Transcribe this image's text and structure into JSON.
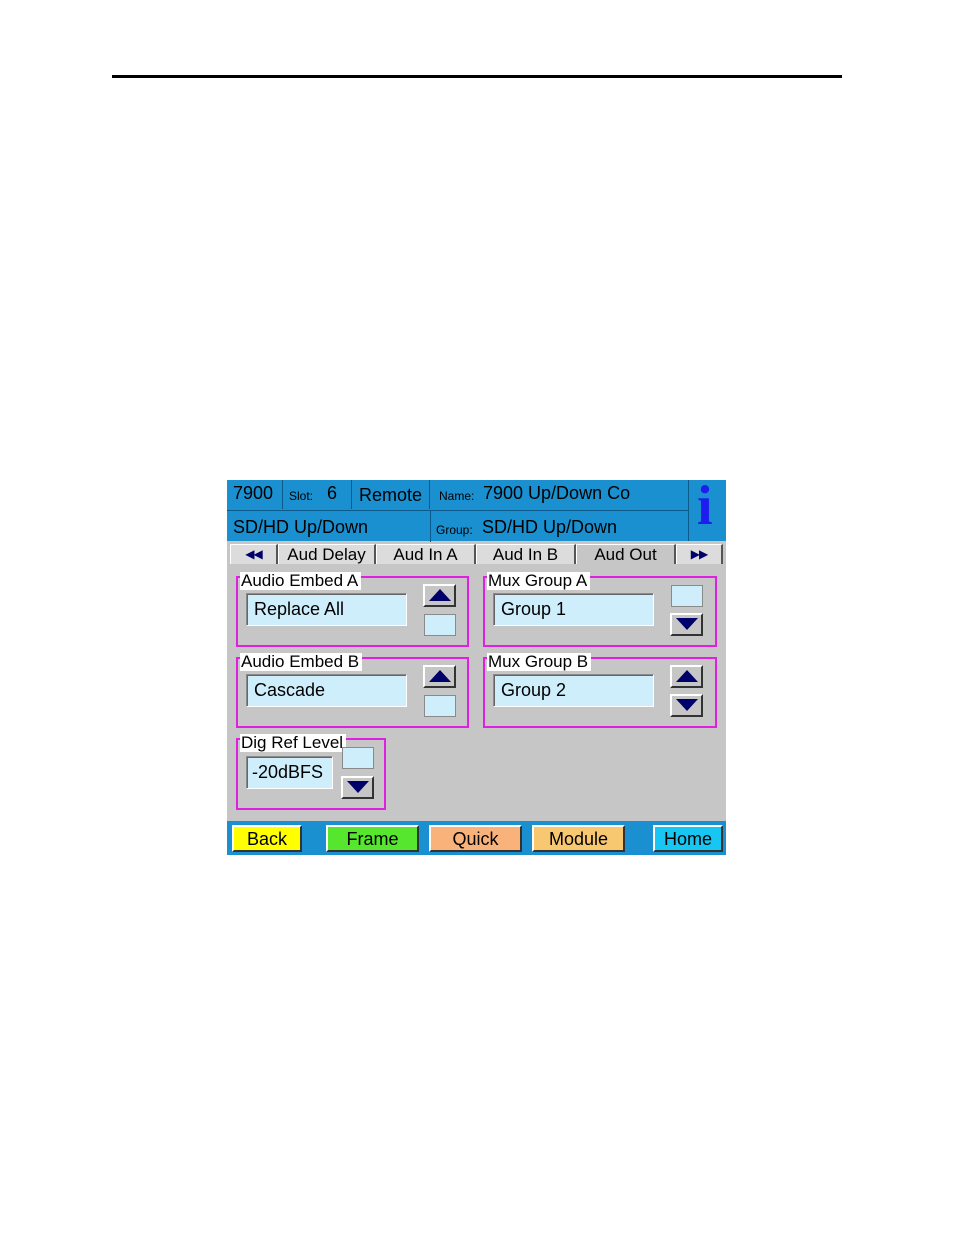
{
  "header": {
    "frame_number": "7900",
    "slot_label": "Slot:",
    "slot_value": "6",
    "mode": "Remote",
    "name_label": "Name:",
    "name_value": "7900 Up/Down Co",
    "module_type": "SD/HD Up/Down",
    "group_label": "Group:",
    "group_value": "SD/HD Up/Down",
    "info_glyph": "i",
    "info_icon": "info-icon"
  },
  "tabs": {
    "prev_glyph": "◀◀",
    "next_glyph": "▶▶",
    "items": [
      "Aud Delay",
      "Aud In A",
      "Aud In B",
      "Aud Out"
    ]
  },
  "controls": {
    "audio_embed_a": {
      "label": "Audio Embed A",
      "value": "Replace All"
    },
    "mux_group_a": {
      "label": "Mux Group A",
      "value": "Group 1"
    },
    "audio_embed_b": {
      "label": "Audio Embed B",
      "value": "Cascade"
    },
    "mux_group_b": {
      "label": "Mux Group B",
      "value": "Group 2"
    },
    "dig_ref_level": {
      "label": "Dig Ref Level",
      "value": "-20dBFS"
    }
  },
  "footer": {
    "back": "Back",
    "frame": "Frame",
    "quick": "Quick",
    "module": "Module",
    "home": "Home"
  },
  "colors": {
    "header_bg": "#1a90d0",
    "group_border": "#e020e0",
    "field_bg": "#cfeefc",
    "back_btn": "#ffff00",
    "frame_btn": "#55e62d",
    "quick_btn": "#f8b27a",
    "module_btn": "#f8c870",
    "home_btn": "#18c6f4",
    "info_icon": "#1d1df0"
  }
}
